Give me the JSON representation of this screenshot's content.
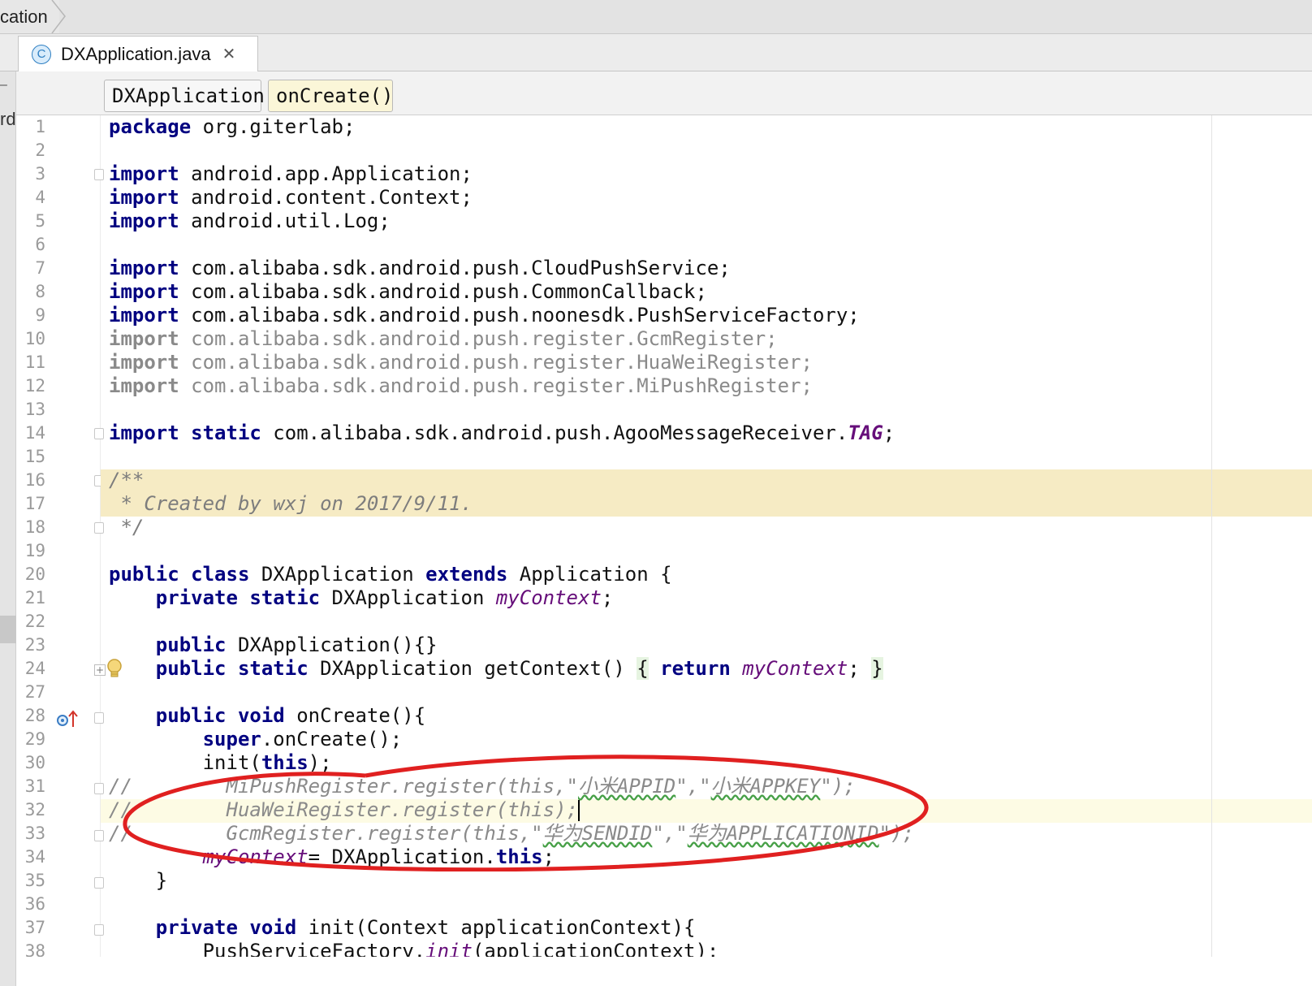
{
  "breadcrumb": {
    "label": "cation"
  },
  "left_strip": {
    "glyph_top": "–",
    "glyph_mid": "rd"
  },
  "editor_tab": {
    "filename": "DXApplication.java",
    "icon_letter": "C",
    "close": "✕"
  },
  "nav": {
    "class_name": "DXApplication",
    "method_name": "onCreate()"
  },
  "code": {
    "l1": [
      "package",
      " org.giterlab;"
    ],
    "l3": [
      "import",
      " android.app.Application;"
    ],
    "l4": [
      "import",
      " android.content.Context;"
    ],
    "l5": [
      "import",
      " android.util.Log;"
    ],
    "l7": [
      "import",
      " com.alibaba.sdk.android.push.CloudPushService;"
    ],
    "l8": [
      "import",
      " com.alibaba.sdk.android.push.CommonCallback;"
    ],
    "l9": [
      "import",
      " com.alibaba.sdk.android.push.noonesdk.PushServiceFactory;"
    ],
    "l10": [
      "import",
      " com.alibaba.sdk.android.push.register.GcmRegister;"
    ],
    "l11": [
      "import",
      " com.alibaba.sdk.android.push.register.HuaWeiRegister;"
    ],
    "l12": [
      "import",
      " com.alibaba.sdk.android.push.register.MiPushRegister;"
    ],
    "l14": [
      "import",
      " ",
      "static",
      " com.alibaba.sdk.android.push.AgooMessageReceiver.",
      "TAG",
      ";"
    ],
    "l16": "/**",
    "l17": " * Created by wxj on 2017/9/11.",
    "l18": " */",
    "l20": [
      "public",
      " ",
      "class",
      " DXApplication ",
      "extends",
      " Application {"
    ],
    "l21": [
      "    ",
      "private",
      " ",
      "static",
      " DXApplication ",
      "myContext",
      ";"
    ],
    "l23": [
      "    ",
      "public",
      " DXApplication(){}"
    ],
    "l24": [
      "    ",
      "public",
      " ",
      "static",
      " DXApplication getContext() ",
      "{",
      " ",
      "return",
      " ",
      "myContext",
      "; ",
      "}"
    ],
    "l28": [
      "    ",
      "public",
      " ",
      "void",
      " onCreate(){"
    ],
    "l29": [
      "        ",
      "super",
      ".onCreate();"
    ],
    "l30": [
      "        init(",
      "this",
      ");"
    ],
    "l31": [
      "//",
      "        MiPushRegister.register(this,\"",
      "小米APPID",
      "\",\"",
      "小米APPKEY",
      "\");"
    ],
    "l32": [
      "//",
      "        HuaWeiRegister.register(this);"
    ],
    "l33": [
      "//",
      "        GcmRegister.register(this,\"",
      "华为SENDID",
      "\",\"",
      "华为APPLICATIONID",
      "\");"
    ],
    "l34": [
      "        ",
      "myContext",
      "= DXApplication.",
      "this",
      ";"
    ],
    "l35": "    }",
    "l37": [
      "    ",
      "private",
      " ",
      "void",
      " init(Context applicationContext){"
    ],
    "l38": [
      "        PushServiceFactory.",
      "init",
      "(applicationContext);"
    ]
  },
  "line_numbers": [
    "1",
    "2",
    "3",
    "4",
    "5",
    "6",
    "7",
    "8",
    "9",
    "10",
    "11",
    "12",
    "13",
    "14",
    "15",
    "16",
    "17",
    "18",
    "19",
    "20",
    "21",
    "22",
    "23",
    "24",
    "27",
    "28",
    "29",
    "30",
    "31",
    "32",
    "33",
    "34",
    "35",
    "36",
    "37",
    "38"
  ],
  "colors": {
    "keyword": "#000080",
    "field": "#660e7a",
    "annotation_ellipse": "#e02020",
    "doc_highlight": "#f6ebc4"
  }
}
